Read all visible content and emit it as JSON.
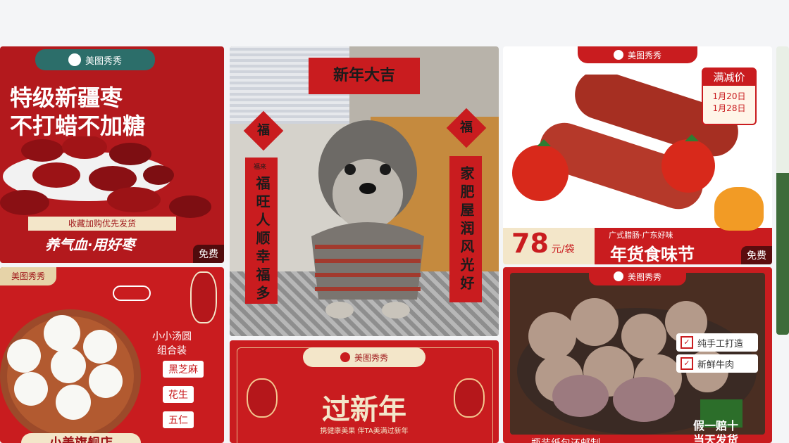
{
  "brand": {
    "name": "美图秀秀"
  },
  "cards": {
    "dates": {
      "title1": "特级新疆枣",
      "title2": "不打蜡不加糖",
      "subtitle": "收藏加购优先发货",
      "slogan": "养气血·用好枣",
      "badge_free": "免费"
    },
    "dog": {
      "banner": "新年大吉",
      "left_diamond": "福",
      "right_diamond": "福",
      "left_couplet": "福旺人顺幸福多",
      "left_tag": "福来",
      "right_couplet": "家肥屋润风光好"
    },
    "sausage": {
      "price_tag_title": "满减价",
      "date1": "1月20日",
      "date2": "1月28日",
      "price": "78",
      "unit": "元/袋",
      "small_label": "广式腊肠·广东好味",
      "fest_title": "年货食味节",
      "badge_free": "免费"
    },
    "tangyuan": {
      "title": "小小汤圆组合装",
      "flavors": [
        "黑芝麻",
        "花生",
        "五仁"
      ],
      "shop_name": "小美旗舰店"
    },
    "newyear": {
      "title": "过新年",
      "subtitle": "携健康美果 伴TA美满过新年"
    },
    "beef": {
      "check1": "纯手工打造",
      "check2": "新鲜牛肉",
      "bottom1": "假一赔十",
      "bottom2": "当天发货",
      "bottom_partial": "瓶装纸包还邮制"
    }
  },
  "colors": {
    "red": "#c91c1f",
    "dark_red": "#9e1418",
    "cream": "#f3e6c9",
    "teal": "#2c6e6a"
  }
}
